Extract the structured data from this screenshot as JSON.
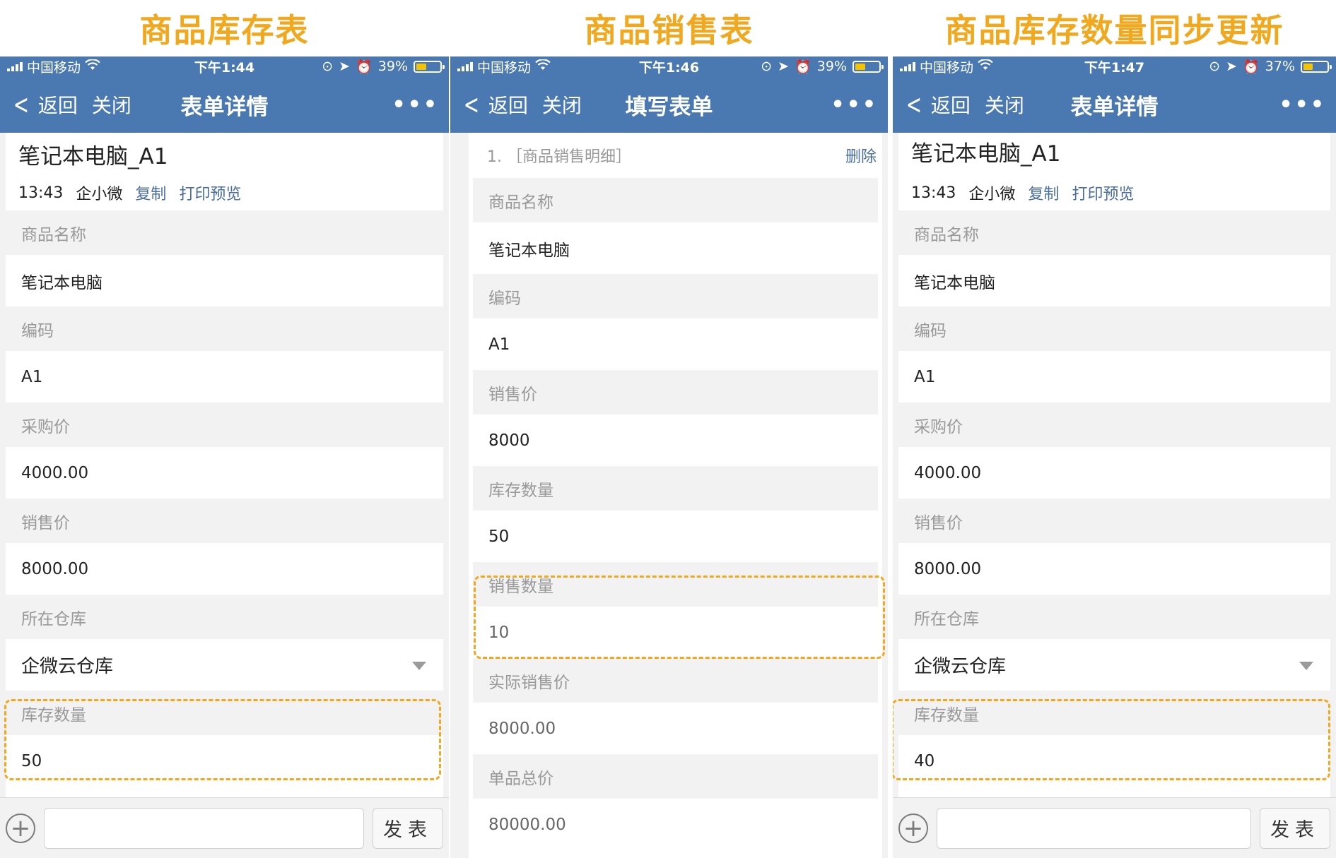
{
  "captions": [
    "商品库存表",
    "商品销售表",
    "商品库存数量同步更新"
  ],
  "phones": [
    {
      "status": {
        "carrier": "中国移动",
        "time": "下午1:44",
        "battery": "39%",
        "battery_level": 0.39
      },
      "nav": {
        "back": "返回",
        "close": "关闭",
        "title": "表单详情",
        "more": "•••"
      },
      "record_title": "笔记本电脑_A1",
      "meta": {
        "time": "13:43",
        "user": "企小微",
        "copy": "复制",
        "print": "打印预览"
      },
      "fields": [
        {
          "label": "商品名称",
          "value": "笔记本电脑"
        },
        {
          "label": "编码",
          "value": "A1"
        },
        {
          "label": "采购价",
          "value": "4000.00"
        },
        {
          "label": "销售价",
          "value": "8000.00"
        },
        {
          "label": "所在仓库",
          "value": "企微云仓库"
        },
        {
          "label": "库存数量",
          "value": "50"
        }
      ],
      "compose": {
        "plus": "+",
        "send": "发表"
      }
    },
    {
      "status": {
        "carrier": "中国移动",
        "time": "下午1:46",
        "battery": "39%",
        "battery_level": 0.39
      },
      "nav": {
        "back": "返回",
        "close": "关闭",
        "title": "填写表单",
        "more": "•••"
      },
      "sub_header": {
        "label": "1. ［商品销售明细］",
        "delete": "删除"
      },
      "fields": [
        {
          "label": "商品名称",
          "value": "笔记本电脑"
        },
        {
          "label": "编码",
          "value": "A1"
        },
        {
          "label": "销售价",
          "value": "8000"
        },
        {
          "label": "库存数量",
          "value": "50"
        },
        {
          "label": "销售数量",
          "value": "10"
        },
        {
          "label": "实际销售价",
          "value": "8000.00"
        },
        {
          "label": "单品总价",
          "value": "80000.00"
        }
      ]
    },
    {
      "status": {
        "carrier": "中国移动",
        "time": "下午1:47",
        "battery": "37%",
        "battery_level": 0.37
      },
      "nav": {
        "back": "返回",
        "close": "关闭",
        "title": "表单详情",
        "more": "•••"
      },
      "record_title": "笔记本电脑_A1",
      "meta": {
        "time": "13:43",
        "user": "企小微",
        "copy": "复制",
        "print": "打印预览"
      },
      "fields": [
        {
          "label": "商品名称",
          "value": "笔记本电脑"
        },
        {
          "label": "编码",
          "value": "A1"
        },
        {
          "label": "采购价",
          "value": "4000.00"
        },
        {
          "label": "销售价",
          "value": "8000.00"
        },
        {
          "label": "所在仓库",
          "value": "企微云仓库"
        },
        {
          "label": "库存数量",
          "value": "40"
        }
      ],
      "compose": {
        "plus": "+",
        "send": "发表"
      }
    }
  ],
  "colors": {
    "nav_blue": "#4a78b0",
    "highlight_orange": "#f0a81e",
    "link_blue": "#4a6ea0"
  }
}
